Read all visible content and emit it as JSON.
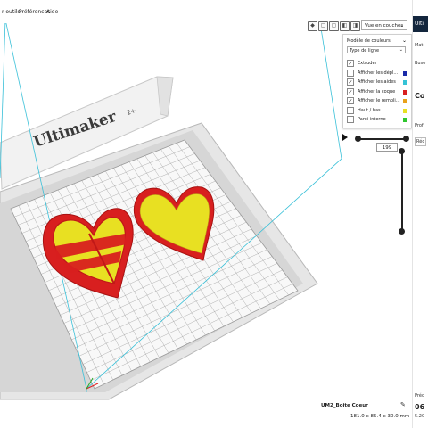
{
  "menu": {
    "items": [
      "r outils",
      "Préférences",
      "Aide"
    ]
  },
  "toolbar": {
    "view_mode": "Vue en couches",
    "icons": [
      "view-3d-icon",
      "view-front-icon",
      "view-top-icon",
      "view-left-icon",
      "view-right-icon"
    ]
  },
  "layer_panel": {
    "color_scheme_label": "Modèle de couleurs",
    "color_scheme_value": "Type de ligne",
    "legend": [
      {
        "label": "Extruder",
        "checked": true,
        "color": ""
      },
      {
        "label": "Afficher les dépl...",
        "checked": false,
        "color": "#1a2aa8"
      },
      {
        "label": "Afficher les aides",
        "checked": true,
        "color": "#35c3d6"
      },
      {
        "label": "Afficher la coque",
        "checked": true,
        "color": "#d81f1f"
      },
      {
        "label": "Afficher le rempli...",
        "checked": true,
        "color": "#e8a11a"
      },
      {
        "label": "Haut / bas",
        "checked": false,
        "color": "#e8e022"
      },
      {
        "label": "Paroi interne",
        "checked": false,
        "color": "#2ec62e"
      }
    ]
  },
  "layer_slider": {
    "current_layer": "199"
  },
  "object": {
    "name": "UM2_Boite Coeur",
    "dimensions": "181.0 x 85.4 x 30.0 mm"
  },
  "printer_brand": "Ultimaker",
  "printer_brand_sup": "2+",
  "right_sidebar": {
    "header": "Ulti",
    "material_label": "Mat",
    "buse_label": "Buse",
    "config_title": "Co",
    "profile_label": "Prof",
    "print_label": "Réc",
    "estimate_label": "Préc",
    "estimate_value": "06",
    "estimate_sub": "5.20"
  },
  "colors": {
    "shell": "#d81f1f",
    "fill": "#e8e022",
    "accent": "#13263d",
    "bbox": "#39c0d8"
  }
}
